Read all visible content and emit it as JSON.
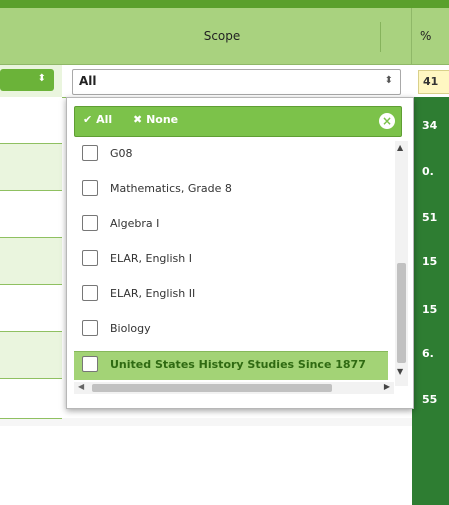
{
  "header": {
    "scope_label": "Scope",
    "pct_label": "%"
  },
  "filter": {
    "selected": "All",
    "pct_value": "41"
  },
  "dropdown": {
    "all_label": "All",
    "none_label": "None",
    "items": [
      {
        "label": "G08",
        "checked": false,
        "highlighted": false
      },
      {
        "label": "Mathematics, Grade 8",
        "checked": false,
        "highlighted": false
      },
      {
        "label": "Algebra I",
        "checked": false,
        "highlighted": false
      },
      {
        "label": "ELAR, English I",
        "checked": false,
        "highlighted": false
      },
      {
        "label": "ELAR, English II",
        "checked": false,
        "highlighted": false
      },
      {
        "label": "Biology",
        "checked": false,
        "highlighted": false
      },
      {
        "label": "United States History Studies Since 1877",
        "checked": false,
        "highlighted": true
      }
    ]
  },
  "right_values": [
    "34",
    "0.",
    "51",
    "15",
    "15",
    "6.",
    "55"
  ],
  "colors": {
    "header_green": "#a9d27f",
    "accent_green": "#7cc24a",
    "dark_green": "#2e7d32",
    "highlight": "#a3d376"
  }
}
